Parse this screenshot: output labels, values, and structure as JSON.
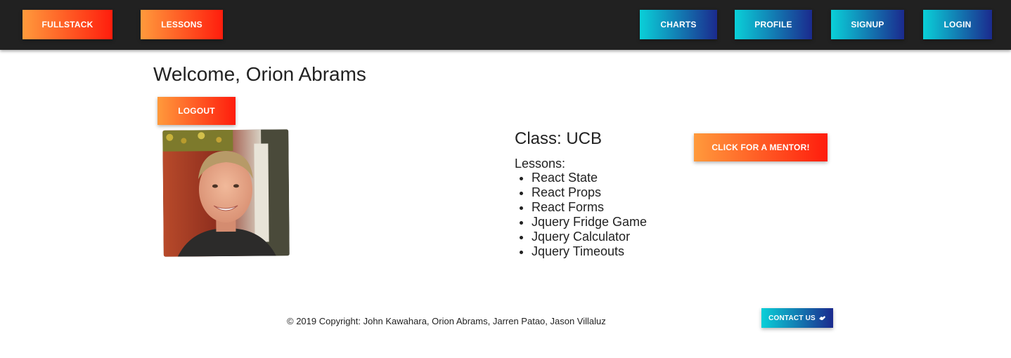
{
  "nav": {
    "left_items": [
      {
        "label": "FULLSTACK"
      },
      {
        "label": "LESSONS"
      }
    ],
    "right_items": [
      {
        "label": "CHARTS"
      },
      {
        "label": "PROFILE"
      },
      {
        "label": "SIGNUP"
      },
      {
        "label": "LOGIN"
      }
    ]
  },
  "profile": {
    "welcome": "Welcome, Orion Abrams",
    "logout_label": "LOGOUT",
    "class_title": "Class: UCB",
    "lessons_label": "Lessons:",
    "lessons": [
      "React State",
      "React Props",
      "React Forms",
      "Jquery Fridge Game",
      "Jquery Calculator",
      "Jquery Timeouts"
    ],
    "mentor_label": "CLICK FOR A MENTOR!"
  },
  "footer": {
    "copyright": "© 2019 Copyright: John Kawahara, Orion Abrams, Jarren Patao, Jason Villaluz",
    "contact_label": "CONTACT US",
    "contact_icon": "handshake-icon"
  },
  "colors": {
    "navbar_bg": "#212121",
    "orange_start": "#ff9a3c",
    "orange_end": "#ff1d0d",
    "blue_start": "#0ad0d8",
    "blue_end": "#1b2a8e"
  }
}
